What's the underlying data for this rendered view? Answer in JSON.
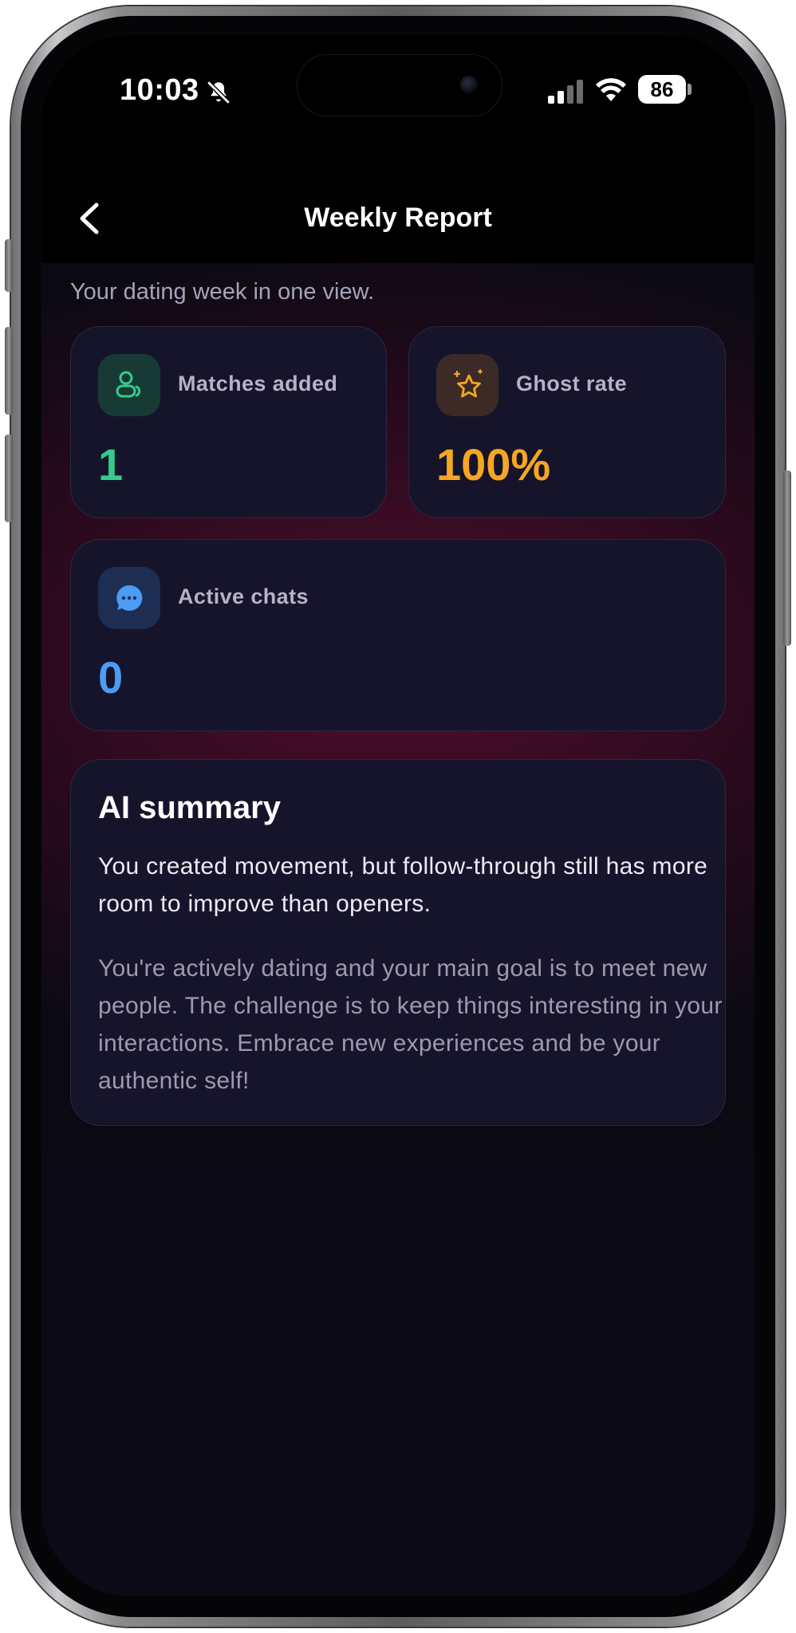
{
  "status_bar": {
    "time": "10:03",
    "battery": "86",
    "icons": [
      "bell-slash-icon",
      "cellular-signal-icon",
      "wifi-icon",
      "battery-icon"
    ]
  },
  "nav": {
    "title": "Weekly Report",
    "back_icon": "chevron-left-icon"
  },
  "subtitle": "Your dating week in one view.",
  "stats": [
    {
      "label": "Matches added",
      "value": "1",
      "icon": "people-icon",
      "color": "#37c98a",
      "icon_bg": "#173a35"
    },
    {
      "label": "Ghost rate",
      "value": "100%",
      "icon": "star-sparkle-icon",
      "color": "#f5a623",
      "icon_bg": "#3b2a26"
    },
    {
      "label": "Active chats",
      "value": "0",
      "icon": "chat-bubble-icon",
      "color": "#4a9cf5",
      "icon_bg": "#1e2d52"
    }
  ],
  "summary": {
    "title": "AI summary",
    "lead": "You created movement, but follow-through still has more room to improve than openers.",
    "body": "You're actively dating and your main goal is to meet new people. The challenge is to keep things interesting in your interactions. Embrace new experiences and be your authentic self!"
  },
  "colors": {
    "background": "#0b0a12",
    "card": "#16142a",
    "accent_glow": "#5c0e2e"
  }
}
